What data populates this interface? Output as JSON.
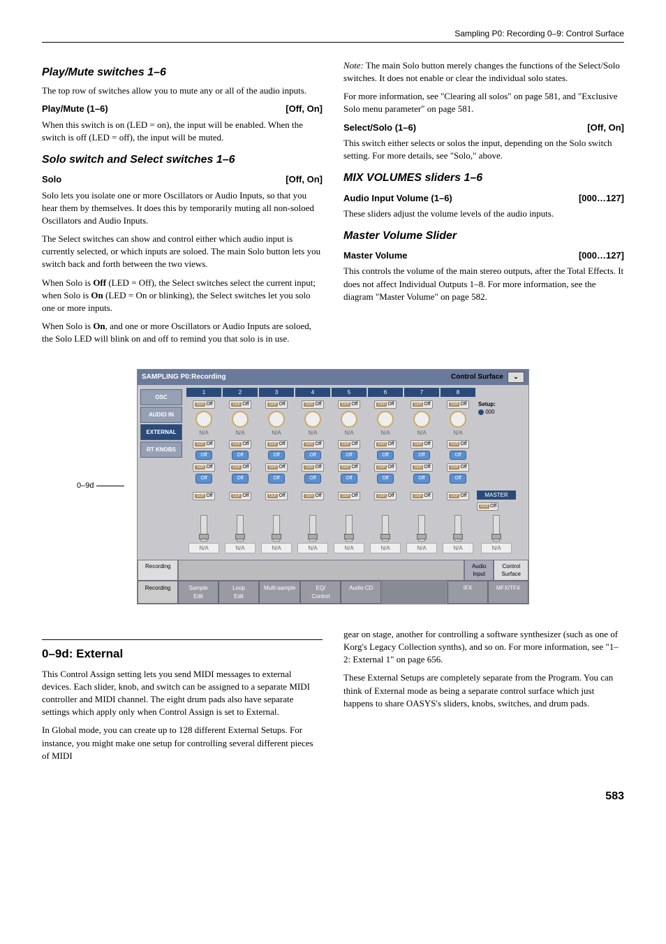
{
  "header": "Sampling P0: Recording    0–9: Control Surface",
  "col1": {
    "h_playmute": "Play/Mute switches 1–6",
    "p1": "The top row of switches allow you to mute any or all of the audio inputs.",
    "param_playmute_l": "Play/Mute (1–6)",
    "param_playmute_r": "[Off, On]",
    "p2": "When this switch is on (LED = on), the input will be enabled. When the switch is off (LED = off), the input will be muted.",
    "h_solo": "Solo switch and Select switches 1–6",
    "param_solo_l": "Solo",
    "param_solo_r": "[Off, On]",
    "p3": "Solo lets you isolate one or more Oscillators or Audio Inputs, so that you hear them by themselves. It does this by temporarily muting all non-soloed Oscillators and Audio Inputs.",
    "p4": "The Select switches can show and control either which audio input is currently selected, or which inputs are soloed. The main Solo button lets you switch back and forth between the two views.",
    "p5a": "When Solo is ",
    "p5b": "Off",
    "p5c": " (LED = Off), the Select switches select the current input; when Solo is ",
    "p5d": "On",
    "p5e": " (LED = On or blinking), the Select switches let you solo one or more inputs.",
    "p6a": "When Solo is ",
    "p6b": "On",
    "p6c": ", and one or more Oscillators or Audio Inputs are soloed, the Solo LED will blink on and off to remind you that solo is in use."
  },
  "col2": {
    "p1a": "Note:",
    "p1b": " The main Solo button merely changes the functions of the Select/Solo switches. It does not enable or clear the individual solo states.",
    "p2": "For more information, see \"Clearing all solos\" on page 581, and \"Exclusive Solo menu parameter\" on page 581.",
    "param_selsolo_l": "Select/Solo (1–6)",
    "param_selsolo_r": "[Off, On]",
    "p3": "This switch either selects or solos the input, depending on the Solo switch setting. For more details, see \"Solo,\" above.",
    "h_mixvol": "MIX VOLUMES sliders 1–6",
    "param_audioinput_l": "Audio Input Volume (1–6)",
    "param_audioinput_r": "[000…127]",
    "p4": "These sliders adjust the volume levels of the audio inputs.",
    "h_mastervol": "Master Volume Slider",
    "param_mastervol_l": "Master Volume",
    "param_mastervol_r": "[000…127]",
    "p5": "This controls the volume of the main stereo outputs, after the Total Effects. It does not affect Individual Outputs 1–8. For more information, see the diagram \"Master Volume\" on page 582."
  },
  "screenshot": {
    "title": "SAMPLING P0:Recording",
    "right_label": "Control Surface",
    "callout": "0–9d",
    "left_tabs": [
      "OSC",
      "AUDIO IN",
      "EXTERNAL",
      "RT KNOBS"
    ],
    "columns": [
      "1",
      "2",
      "3",
      "4",
      "5",
      "6",
      "7",
      "8"
    ],
    "off_label": "Off",
    "off_btn": "Off",
    "na": "N/A",
    "setup_label": "Setup:",
    "setup_val": "000",
    "master_label": "MASTER",
    "bottom_tabs1": {
      "left": "Recording",
      "right1": "Audio Input",
      "right2": "Control Surface"
    },
    "bottom_tabs2": [
      "Recording",
      "Sample Edit",
      "Loop Edit",
      "Multi-sample",
      "EQ/Control",
      "Audio CD",
      "IFX",
      "MFX/TFX"
    ]
  },
  "section2": {
    "h": "0–9d: External",
    "col1_p1": "This Control Assign setting lets you send MIDI messages to external devices. Each slider, knob, and switch can be assigned to a separate MIDI controller and MIDI channel. The eight drum pads also have separate settings which apply only when Control Assign is set to External.",
    "col1_p2": "In Global mode, you can create up to 128 different External Setups. For instance, you might make one setup for controlling several different pieces of MIDI",
    "col2_p1": "gear on stage, another for controlling a software synthesizer (such as one of Korg's Legacy Collection synths), and so on. For more information, see \"1–2: External 1\" on page 656.",
    "col2_p2": "These External Setups are completely separate from the Program. You can think of External mode as being a separate control surface which just happens to share OASYS's sliders, knobs, switches, and drum pads."
  },
  "page_num": "583"
}
